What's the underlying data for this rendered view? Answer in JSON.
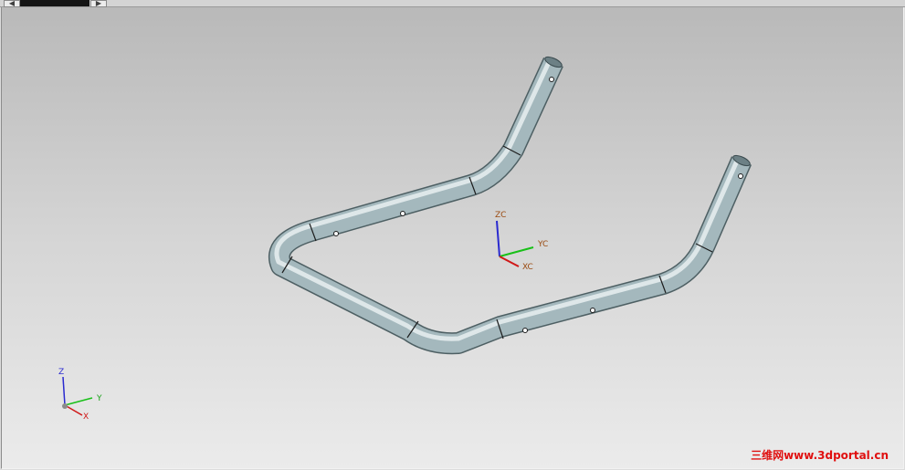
{
  "toolbar": {
    "scroll_left_glyph": "◀",
    "scroll_right_glyph": "▶"
  },
  "wcs_axes": {
    "z_label": "ZC",
    "y_label": "YC",
    "x_label": "XC",
    "z_color": "#2a2ad0",
    "y_color": "#18c018",
    "x_color": "#d01818"
  },
  "abs_axes": {
    "z_label": "Z",
    "y_label": "Y",
    "x_label": "X"
  },
  "watermark": {
    "text": "三维网www.3dportal.cn",
    "color": "#e01010"
  },
  "model": {
    "tube_color": "#a4b8bd"
  }
}
